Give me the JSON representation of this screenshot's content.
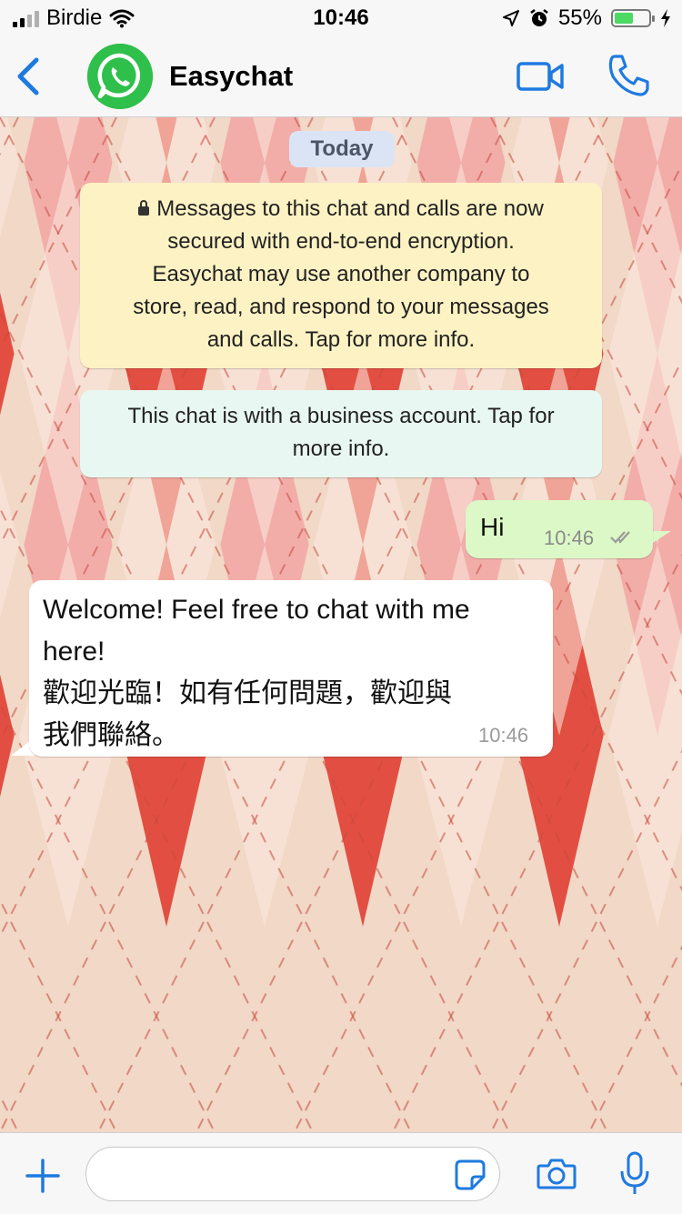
{
  "status_bar": {
    "carrier": "Birdie",
    "time": "10:46",
    "battery_percent": "55%",
    "battery_level": 0.55,
    "icons": [
      "signal-icon",
      "wifi-icon",
      "location-icon",
      "alarm-icon",
      "battery-icon",
      "charging-icon"
    ]
  },
  "header": {
    "title": "Easychat",
    "icons": [
      "back-chevron-icon",
      "whatsapp-logo",
      "video-call-icon",
      "phone-icon"
    ]
  },
  "chat": {
    "date_label": "Today",
    "encryption_notice": {
      "lines": [
        "Messages to this chat and calls are now",
        "secured with end-to-end encryption.",
        "Easychat may use another company to",
        "store, read, and respond to your messages",
        "and calls. Tap for more info."
      ]
    },
    "business_notice": {
      "lines": [
        "This chat is with a business account. Tap for",
        "more info."
      ]
    },
    "messages": [
      {
        "direction": "outgoing",
        "text": "Hi",
        "time": "10:46",
        "status": "read"
      },
      {
        "direction": "incoming",
        "lines": [
          "Welcome! Feel free to chat with me",
          "here!",
          "歡迎光臨！如有任何問題，歡迎與",
          "我們聯絡。"
        ],
        "time": "10:46"
      }
    ]
  },
  "composer": {
    "placeholder": "",
    "value": "",
    "icons": [
      "plus-icon",
      "sticker-icon",
      "camera-icon",
      "microphone-icon"
    ]
  },
  "colors": {
    "accent": "#1f7ae0",
    "outgoing_bubble": "#dcf8c6",
    "incoming_bubble": "#ffffff",
    "encryption_notice_bg": "#fdf2c3",
    "business_notice_bg": "#e8f7f1",
    "date_pill_bg": "#dbe4f5",
    "battery_fill": "#4cd964",
    "wallpaper_base": "#f1d8c7",
    "wallpaper_diamond_red": "#e0483b",
    "wallpaper_diamond_pink": "#f2a3a1"
  }
}
